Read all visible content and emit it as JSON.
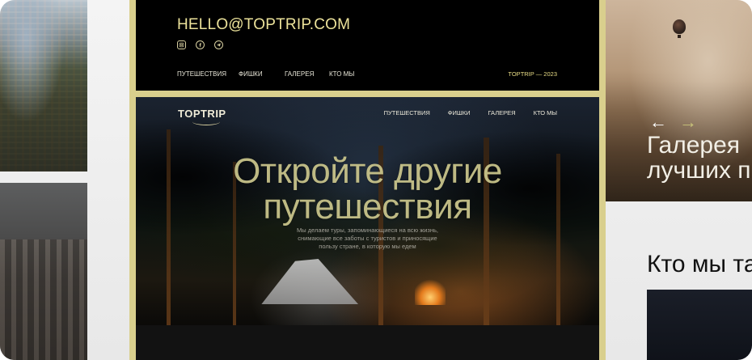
{
  "footer": {
    "email": "HELLO@TOPTRIP.COM",
    "nav": [
      "ПУТЕШЕСТВИЯ",
      "ФИШКИ",
      "ГАЛЕРЕЯ",
      "КТО МЫ"
    ],
    "copyright": "TOPTRIP — 2023",
    "social_icons": [
      "instagram-icon",
      "facebook-icon",
      "telegram-icon"
    ]
  },
  "hero": {
    "logo": "TOPTRIP",
    "nav": [
      "ПУТЕШЕСТВИЯ",
      "ФИШКИ",
      "ГАЛЕРЕЯ",
      "КТО МЫ"
    ],
    "title_line1": "Откройте другие",
    "title_line2": "путешествия",
    "subtitle_line1": "Мы делаем туры, запоминающиеся на всю жизнь,",
    "subtitle_line2": "снимающие все заботы с туристов и приносящие",
    "subtitle_line3": "пользу стране, в которую мы едем"
  },
  "right": {
    "gallery_line1": "Галерея",
    "gallery_line2": "лучших п",
    "who_title": "Кто мы та",
    "arrow_left": "←",
    "arrow_right": "→"
  },
  "colors": {
    "gold": "#d9cf8d",
    "accent_text": "#ece29a"
  }
}
